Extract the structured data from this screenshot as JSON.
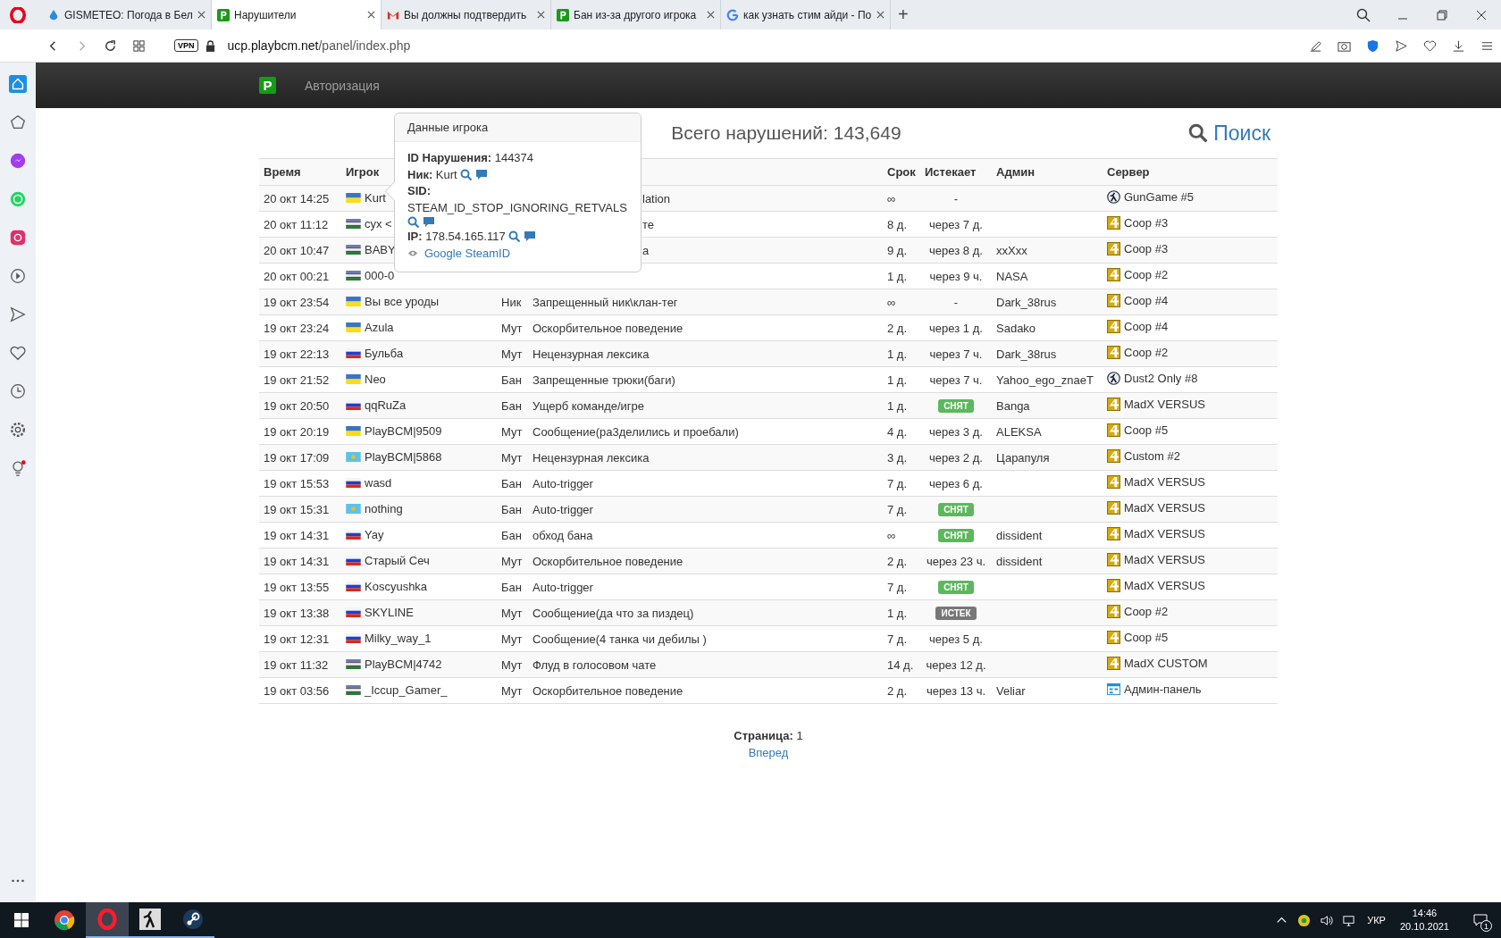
{
  "browser": {
    "tabs": [
      {
        "title": "GISMETEO: Погода в Бел",
        "kind": "drop",
        "selected": false
      },
      {
        "title": "Нарушители",
        "kind": "p",
        "selected": true
      },
      {
        "title": "Вы должны подтвердить",
        "kind": "mail",
        "selected": false
      },
      {
        "title": "Бан из-за другого игрока",
        "kind": "p",
        "selected": false
      },
      {
        "title": "как узнать стим айди - По",
        "kind": "g",
        "selected": false
      }
    ],
    "new_tab": "+",
    "vpn": "VPN",
    "url_host": "ucp.playbcm.net",
    "url_path": "/panel/index.php"
  },
  "site_nav": {
    "logo": "P",
    "link": "Авторизация"
  },
  "summary": "Всего нарушений: 143,649",
  "search_link": "Поиск",
  "table": {
    "columns": [
      {
        "label": "Время"
      },
      {
        "label": "Игрок"
      },
      {},
      {},
      {
        "label": "Срок"
      },
      {
        "label": "Истекает"
      },
      {
        "label": "Админ"
      },
      {
        "label": "Сервер"
      }
    ],
    "rows": [
      {
        "time": "20 окт 14:25",
        "flag": {
          "kind": "ua"
        },
        "player": "Kurt",
        "reason": "lation",
        "partial": true,
        "term": "∞",
        "expires": {
          "kind": "text",
          "text": "-"
        },
        "server": {
          "kind": "cs",
          "name": "GunGame #5"
        }
      },
      {
        "time": "20 окт 11:12",
        "flag": {
          "kind": "uz"
        },
        "player": "cyx <",
        "reason": "те",
        "partial": true,
        "term": "8 д.",
        "expires": {
          "kind": "text",
          "text": "через 7 д."
        },
        "server": {
          "kind": "l4d",
          "name": "Coop #3"
        }
      },
      {
        "time": "20 окт 10:47",
        "flag": {
          "kind": "uz"
        },
        "player": "BABY",
        "reason": "а",
        "partial": true,
        "term": "9 д.",
        "expires": {
          "kind": "text",
          "text": "через 8 д."
        },
        "admin": "xxXxx",
        "server": {
          "kind": "l4d",
          "name": "Coop #3"
        }
      },
      {
        "time": "20 окт 00:21",
        "flag": {
          "kind": "uz"
        },
        "player": "000-0",
        "term": "1 д.",
        "expires": {
          "kind": "text",
          "text": "через 9 ч."
        },
        "admin": "NASA",
        "server": {
          "kind": "l4d",
          "name": "Coop #2"
        }
      },
      {
        "time": "19 окт 23:54",
        "flag": {
          "kind": "ua"
        },
        "player": "Вы все уроды",
        "type": "Ник",
        "reason": "Запрещенный ник\\клан-тег",
        "partial": false,
        "term": "∞",
        "expires": {
          "kind": "text",
          "text": "-"
        },
        "admin": "Dark_38rus",
        "server": {
          "kind": "l4d",
          "name": "Coop #4"
        }
      },
      {
        "time": "19 окт 23:24",
        "flag": {
          "kind": "ua"
        },
        "player": "Azula",
        "type": "Мут",
        "reason": "Оскорбительное поведение",
        "partial": false,
        "term": "2 д.",
        "expires": {
          "kind": "text",
          "text": "через 1 д."
        },
        "admin": "Sadako",
        "server": {
          "kind": "l4d",
          "name": "Coop #4"
        }
      },
      {
        "time": "19 окт 22:13",
        "flag": {
          "kind": "ru"
        },
        "player": "Бульба",
        "type": "Мут",
        "reason": "Нецензурная лексика",
        "partial": false,
        "term": "1 д.",
        "expires": {
          "kind": "text",
          "text": "через 7 ч."
        },
        "admin": "Dark_38rus",
        "server": {
          "kind": "l4d",
          "name": "Coop #2"
        }
      },
      {
        "time": "19 окт 21:52",
        "flag": {
          "kind": "ua"
        },
        "player": "Neo",
        "type": "Бан",
        "reason": "Запрещенные трюки(баги)",
        "partial": false,
        "term": "1 д.",
        "expires": {
          "kind": "text",
          "text": "через 7 ч."
        },
        "admin": "Yahoo_ego_znaeT",
        "server": {
          "kind": "cs",
          "name": "Dust2 Only #8"
        }
      },
      {
        "time": "19 окт 20:50",
        "flag": {
          "kind": "ru"
        },
        "player": "qqRuZa",
        "type": "Бан",
        "reason": "Ущерб команде/игре",
        "partial": false,
        "term": "1 д.",
        "expires": {
          "kind": "removed",
          "text": "СНЯТ"
        },
        "admin": "Banga",
        "server": {
          "kind": "l4d",
          "name": "MadX VERSUS"
        }
      },
      {
        "time": "19 окт 20:19",
        "flag": {
          "kind": "ua"
        },
        "player": "PlayBCM|9509",
        "type": "Мут",
        "reason": "Сообщение(ра3делились и проебали)",
        "partial": false,
        "term": "4 д.",
        "expires": {
          "kind": "text",
          "text": "через 3 д."
        },
        "admin": "ALEKSA",
        "server": {
          "kind": "l4d",
          "name": "Coop #5"
        }
      },
      {
        "time": "19 окт 17:09",
        "flag": {
          "kind": "kz"
        },
        "player": "PlayBCM|5868",
        "type": "Мут",
        "reason": "Нецензурная лексика",
        "partial": false,
        "term": "3 д.",
        "expires": {
          "kind": "text",
          "text": "через 2 д."
        },
        "admin": "Царапуля",
        "server": {
          "kind": "l4d",
          "name": "Custom #2"
        }
      },
      {
        "time": "19 окт 15:53",
        "flag": {
          "kind": "ru"
        },
        "player": "wasd",
        "type": "Бан",
        "reason": "Auto-trigger",
        "partial": false,
        "term": "7 д.",
        "expires": {
          "kind": "text",
          "text": "через 6 д."
        },
        "server": {
          "kind": "l4d",
          "name": "MadX VERSUS"
        }
      },
      {
        "time": "19 окт 15:31",
        "flag": {
          "kind": "kz"
        },
        "player": "nothing",
        "type": "Бан",
        "reason": "Auto-trigger",
        "partial": false,
        "term": "7 д.",
        "expires": {
          "kind": "removed",
          "text": "СНЯТ"
        },
        "server": {
          "kind": "l4d",
          "name": "MadX VERSUS"
        }
      },
      {
        "time": "19 окт 14:31",
        "flag": {
          "kind": "ru"
        },
        "player": "Yay",
        "type": "Бан",
        "reason": "обход бана",
        "partial": false,
        "term": "∞",
        "expires": {
          "kind": "removed",
          "text": "СНЯТ"
        },
        "admin": "dissident",
        "server": {
          "kind": "l4d",
          "name": "MadX VERSUS"
        }
      },
      {
        "time": "19 окт 14:31",
        "flag": {
          "kind": "ru"
        },
        "player": "Старый Сеч",
        "type": "Мут",
        "reason": "Оскорбительное поведение",
        "partial": false,
        "term": "2 д.",
        "expires": {
          "kind": "text",
          "text": "через 23 ч."
        },
        "admin": "dissident",
        "server": {
          "kind": "l4d",
          "name": "MadX VERSUS"
        }
      },
      {
        "time": "19 окт 13:55",
        "flag": {
          "kind": "ru"
        },
        "player": "Koscyushka",
        "type": "Бан",
        "reason": "Auto-trigger",
        "partial": false,
        "term": "7 д.",
        "expires": {
          "kind": "removed",
          "text": "СНЯТ"
        },
        "server": {
          "kind": "l4d",
          "name": "MadX VERSUS"
        }
      },
      {
        "time": "19 окт 13:38",
        "flag": {
          "kind": "ru"
        },
        "player": "SKYLINE",
        "type": "Мут",
        "reason": "Сообщение(да что за пиздец)",
        "partial": false,
        "term": "1 д.",
        "expires": {
          "kind": "expired",
          "text": "ИСТЕК"
        },
        "server": {
          "kind": "l4d",
          "name": "Coop #2"
        }
      },
      {
        "time": "19 окт 12:31",
        "flag": {
          "kind": "ru"
        },
        "player": "Milky_way_1",
        "type": "Мут",
        "reason": "Сообщение(4 танка чи дебилы )",
        "partial": false,
        "term": "7 д.",
        "expires": {
          "kind": "text",
          "text": "через 5 д."
        },
        "server": {
          "kind": "l4d",
          "name": "Coop #5"
        }
      },
      {
        "time": "19 окт 11:32",
        "flag": {
          "kind": "uz"
        },
        "player": "PlayBCM|4742",
        "type": "Мут",
        "reason": "Флуд в голосовом чате",
        "partial": false,
        "term": "14 д.",
        "expires": {
          "kind": "text",
          "text": "через 12 д."
        },
        "server": {
          "kind": "l4d",
          "name": "MadX CUSTOM"
        }
      },
      {
        "time": "19 окт 03:56",
        "flag": {
          "kind": "uz"
        },
        "player": "_Iccup_Gamer_",
        "type": "Мут",
        "reason": "Оскорбительное поведение",
        "partial": false,
        "term": "2 д.",
        "expires": {
          "kind": "text",
          "text": "через 13 ч."
        },
        "admin": "Veliar",
        "server": {
          "kind": "panel",
          "name": "Админ-панель"
        }
      }
    ]
  },
  "popup": {
    "title": "Данные игрока",
    "fields": [
      {
        "label": "ID Нарушения:",
        "value": "144374",
        "kind": "inline",
        "actions": false
      },
      {
        "label": "Ник:",
        "value": "Kurt",
        "kind": "inline",
        "actions": true
      },
      {
        "label": "SID:",
        "value": "STEAM_ID_STOP_IGNORING_RETVALS",
        "kind": "block",
        "actions": true
      },
      {
        "label": "IP:",
        "value": "178.54.165.117",
        "kind": "inline",
        "actions": true
      }
    ],
    "link": "Google SteamID"
  },
  "pagination": {
    "label": "Страница:",
    "page": "1",
    "next": "Вперед"
  },
  "taskbar": {
    "apps": [
      {
        "kind": "chrome",
        "selected": false,
        "running": false
      },
      {
        "kind": "opera",
        "selected": true,
        "running": true
      },
      {
        "kind": "cs",
        "selected": false,
        "running": true
      },
      {
        "kind": "steam",
        "selected": false,
        "running": true
      }
    ],
    "language": "УКР",
    "time": "14:46",
    "date": "20.10.2021",
    "notifications": "1"
  }
}
